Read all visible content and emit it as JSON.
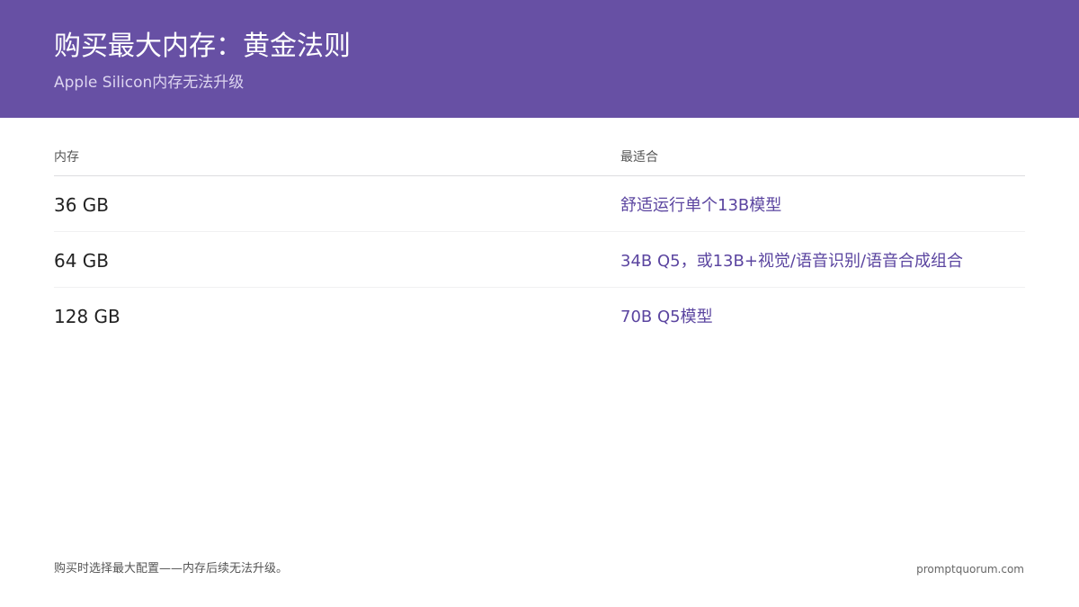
{
  "header": {
    "title": "购买最大内存：黄金法则",
    "subtitle": "Apple Silicon内存无法升级",
    "background_color": "#6750a4"
  },
  "table": {
    "columns": [
      "内存",
      "最适合"
    ],
    "rows": [
      {
        "memory": "36 GB",
        "best_for": "舒适运行单个13B模型"
      },
      {
        "memory": "64 GB",
        "best_for": "34B Q5，或13B+视觉/语音识别/语音合成组合"
      },
      {
        "memory": "128 GB",
        "best_for": "70B Q5模型"
      }
    ],
    "accent_color": "#5b45a0"
  },
  "footer": {
    "note": "购买时选择最大配置——内存后续无法升级。",
    "site": "promptquorum.com"
  }
}
